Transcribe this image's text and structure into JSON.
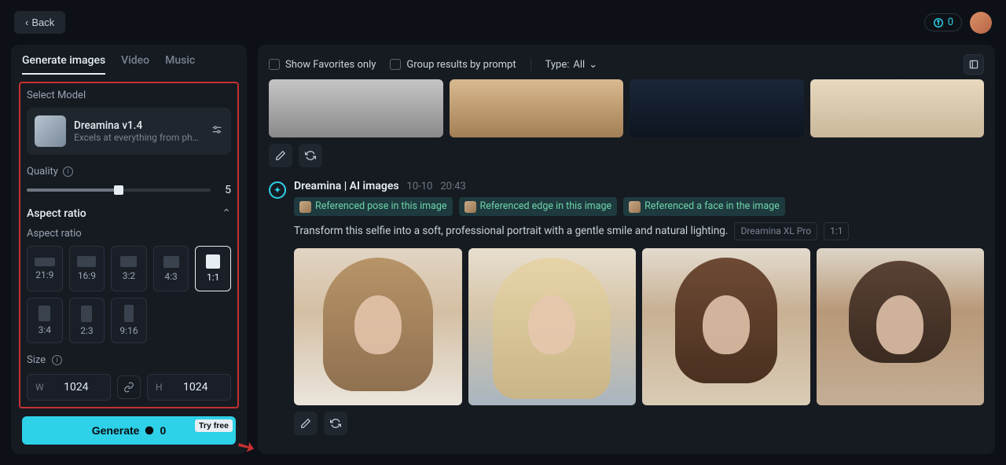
{
  "header": {
    "back": "Back",
    "credits": "0"
  },
  "tabs": {
    "images": "Generate images",
    "video": "Video",
    "music": "Music"
  },
  "model": {
    "section_label": "Select Model",
    "name": "Dreamina v1.4",
    "desc": "Excels at everything from photoreali..."
  },
  "quality": {
    "label": "Quality",
    "value": "5"
  },
  "aspect": {
    "header": "Aspect ratio",
    "sub_label": "Aspect ratio",
    "ratios": [
      "21:9",
      "16:9",
      "3:2",
      "4:3",
      "1:1",
      "3:4",
      "2:3",
      "9:16"
    ]
  },
  "size": {
    "label": "Size",
    "w_label": "W",
    "h_label": "H",
    "w": "1024",
    "h": "1024"
  },
  "generate": {
    "label": "Generate",
    "cost": "0",
    "try_free": "Try free"
  },
  "filters": {
    "favorites": "Show Favorites only",
    "group": "Group results by prompt",
    "type_label": "Type:",
    "type_value": "All"
  },
  "generation": {
    "source": "Dreamina | AI images",
    "date": "10-10",
    "time": "20:43",
    "ref_pose": "Referenced pose in this image",
    "ref_edge": "Referenced edge in this image",
    "ref_face": "Referenced a face in the image",
    "prompt": "Transform this selfie into a soft, professional portrait with a gentle smile and natural lighting.",
    "model_tag": "Dreamina XL Pro",
    "ratio_tag": "1:1"
  }
}
